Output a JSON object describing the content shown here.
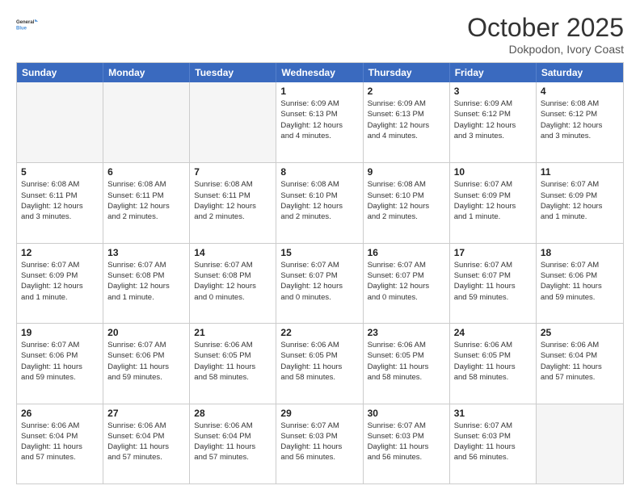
{
  "logo": {
    "line1": "General",
    "line2": "Blue"
  },
  "title": "October 2025",
  "subtitle": "Dokpodon, Ivory Coast",
  "days_of_week": [
    "Sunday",
    "Monday",
    "Tuesday",
    "Wednesday",
    "Thursday",
    "Friday",
    "Saturday"
  ],
  "weeks": [
    [
      {
        "day": "",
        "info": ""
      },
      {
        "day": "",
        "info": ""
      },
      {
        "day": "",
        "info": ""
      },
      {
        "day": "1",
        "info": "Sunrise: 6:09 AM\nSunset: 6:13 PM\nDaylight: 12 hours\nand 4 minutes."
      },
      {
        "day": "2",
        "info": "Sunrise: 6:09 AM\nSunset: 6:13 PM\nDaylight: 12 hours\nand 4 minutes."
      },
      {
        "day": "3",
        "info": "Sunrise: 6:09 AM\nSunset: 6:12 PM\nDaylight: 12 hours\nand 3 minutes."
      },
      {
        "day": "4",
        "info": "Sunrise: 6:08 AM\nSunset: 6:12 PM\nDaylight: 12 hours\nand 3 minutes."
      }
    ],
    [
      {
        "day": "5",
        "info": "Sunrise: 6:08 AM\nSunset: 6:11 PM\nDaylight: 12 hours\nand 3 minutes."
      },
      {
        "day": "6",
        "info": "Sunrise: 6:08 AM\nSunset: 6:11 PM\nDaylight: 12 hours\nand 2 minutes."
      },
      {
        "day": "7",
        "info": "Sunrise: 6:08 AM\nSunset: 6:11 PM\nDaylight: 12 hours\nand 2 minutes."
      },
      {
        "day": "8",
        "info": "Sunrise: 6:08 AM\nSunset: 6:10 PM\nDaylight: 12 hours\nand 2 minutes."
      },
      {
        "day": "9",
        "info": "Sunrise: 6:08 AM\nSunset: 6:10 PM\nDaylight: 12 hours\nand 2 minutes."
      },
      {
        "day": "10",
        "info": "Sunrise: 6:07 AM\nSunset: 6:09 PM\nDaylight: 12 hours\nand 1 minute."
      },
      {
        "day": "11",
        "info": "Sunrise: 6:07 AM\nSunset: 6:09 PM\nDaylight: 12 hours\nand 1 minute."
      }
    ],
    [
      {
        "day": "12",
        "info": "Sunrise: 6:07 AM\nSunset: 6:09 PM\nDaylight: 12 hours\nand 1 minute."
      },
      {
        "day": "13",
        "info": "Sunrise: 6:07 AM\nSunset: 6:08 PM\nDaylight: 12 hours\nand 1 minute."
      },
      {
        "day": "14",
        "info": "Sunrise: 6:07 AM\nSunset: 6:08 PM\nDaylight: 12 hours\nand 0 minutes."
      },
      {
        "day": "15",
        "info": "Sunrise: 6:07 AM\nSunset: 6:07 PM\nDaylight: 12 hours\nand 0 minutes."
      },
      {
        "day": "16",
        "info": "Sunrise: 6:07 AM\nSunset: 6:07 PM\nDaylight: 12 hours\nand 0 minutes."
      },
      {
        "day": "17",
        "info": "Sunrise: 6:07 AM\nSunset: 6:07 PM\nDaylight: 11 hours\nand 59 minutes."
      },
      {
        "day": "18",
        "info": "Sunrise: 6:07 AM\nSunset: 6:06 PM\nDaylight: 11 hours\nand 59 minutes."
      }
    ],
    [
      {
        "day": "19",
        "info": "Sunrise: 6:07 AM\nSunset: 6:06 PM\nDaylight: 11 hours\nand 59 minutes."
      },
      {
        "day": "20",
        "info": "Sunrise: 6:07 AM\nSunset: 6:06 PM\nDaylight: 11 hours\nand 59 minutes."
      },
      {
        "day": "21",
        "info": "Sunrise: 6:06 AM\nSunset: 6:05 PM\nDaylight: 11 hours\nand 58 minutes."
      },
      {
        "day": "22",
        "info": "Sunrise: 6:06 AM\nSunset: 6:05 PM\nDaylight: 11 hours\nand 58 minutes."
      },
      {
        "day": "23",
        "info": "Sunrise: 6:06 AM\nSunset: 6:05 PM\nDaylight: 11 hours\nand 58 minutes."
      },
      {
        "day": "24",
        "info": "Sunrise: 6:06 AM\nSunset: 6:05 PM\nDaylight: 11 hours\nand 58 minutes."
      },
      {
        "day": "25",
        "info": "Sunrise: 6:06 AM\nSunset: 6:04 PM\nDaylight: 11 hours\nand 57 minutes."
      }
    ],
    [
      {
        "day": "26",
        "info": "Sunrise: 6:06 AM\nSunset: 6:04 PM\nDaylight: 11 hours\nand 57 minutes."
      },
      {
        "day": "27",
        "info": "Sunrise: 6:06 AM\nSunset: 6:04 PM\nDaylight: 11 hours\nand 57 minutes."
      },
      {
        "day": "28",
        "info": "Sunrise: 6:06 AM\nSunset: 6:04 PM\nDaylight: 11 hours\nand 57 minutes."
      },
      {
        "day": "29",
        "info": "Sunrise: 6:07 AM\nSunset: 6:03 PM\nDaylight: 11 hours\nand 56 minutes."
      },
      {
        "day": "30",
        "info": "Sunrise: 6:07 AM\nSunset: 6:03 PM\nDaylight: 11 hours\nand 56 minutes."
      },
      {
        "day": "31",
        "info": "Sunrise: 6:07 AM\nSunset: 6:03 PM\nDaylight: 11 hours\nand 56 minutes."
      },
      {
        "day": "",
        "info": ""
      }
    ]
  ]
}
